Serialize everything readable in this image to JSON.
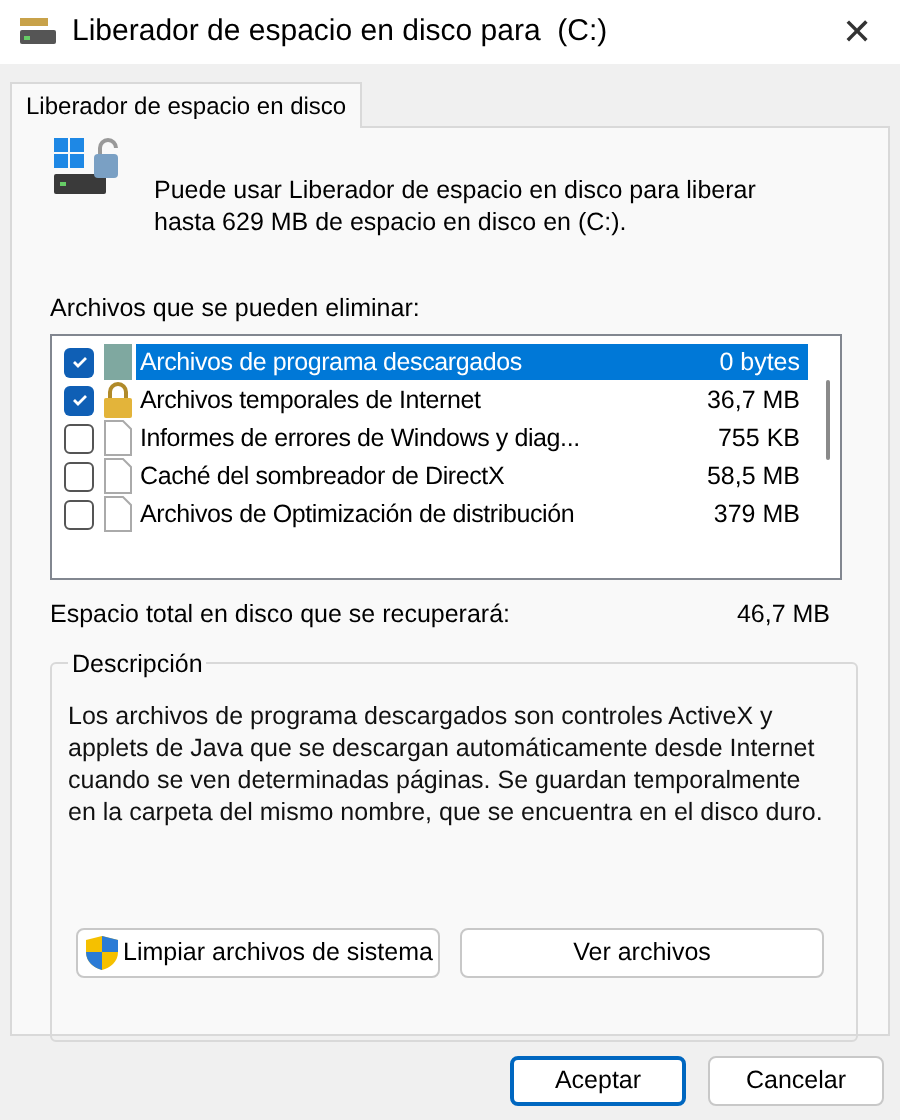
{
  "window": {
    "title": "Liberador de espacio en disco para  (C:)",
    "close": "✕"
  },
  "tabs": [
    {
      "label": "Liberador de espacio en disco",
      "selected": true
    }
  ],
  "intro": "Puede usar Liberador de espacio en disco para liberar hasta 629 MB de espacio en disco en  (C:).",
  "list_label": "Archivos que se pueden eliminar:",
  "files": [
    {
      "name": "Archivos de programa descargados",
      "size": "0 bytes",
      "checked": true,
      "selected": true,
      "kind": "folder"
    },
    {
      "name": "Archivos temporales de Internet",
      "size": "36,7 MB",
      "checked": true,
      "selected": false,
      "kind": "lock"
    },
    {
      "name": "Informes de errores de Windows y diag...",
      "size": "755 KB",
      "checked": false,
      "selected": false,
      "kind": "document"
    },
    {
      "name": "Caché del sombreador de DirectX",
      "size": "58,5 MB",
      "checked": false,
      "selected": false,
      "kind": "document"
    },
    {
      "name": "Archivos de Optimización de distribución",
      "size": "379 MB",
      "checked": false,
      "selected": false,
      "kind": "document"
    }
  ],
  "total": {
    "label": "Espacio total en disco que se recuperará:",
    "value": "46,7 MB"
  },
  "description": {
    "title": "Descripción",
    "text": "Los archivos de programa descargados son controles ActiveX y applets de Java que se descargan automáticamente desde Internet cuando se ven determinadas páginas. Se guardan temporalmente en la carpeta del mismo nombre, que se encuentra en el disco duro."
  },
  "actions": [
    "Limpiar archivos de sistema",
    "Ver archivos"
  ],
  "buttons": [
    "Aceptar",
    "Cancelar"
  ]
}
